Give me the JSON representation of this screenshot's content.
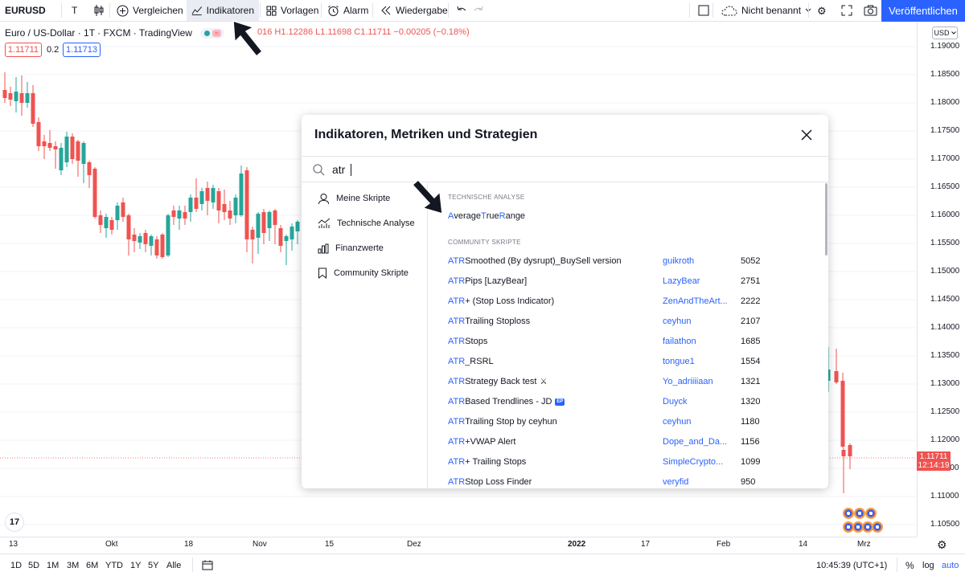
{
  "toolbar": {
    "symbol": "EURUSD",
    "compare_label": "Vergleichen",
    "indicators_label": "Indikatoren",
    "templates_label": "Vorlagen",
    "alert_label": "Alarm",
    "replay_label": "Wiedergabe",
    "layout_name": "Nicht benannt",
    "publish_label": "Veröffentlichen",
    "text_tool": "T"
  },
  "legend": {
    "title": "Euro / US-Dollar · 1T · FXCM · TradingView",
    "ohlc": "016 H1.12286 L1.11698 C1.11711 −0.00205 (−0.18%)",
    "bid": "1.11711",
    "spread": "0.2",
    "ask": "1.11713"
  },
  "price_axis": {
    "currency": "USD",
    "ticks": [
      "1.19000",
      "1.18500",
      "1.18000",
      "1.17500",
      "1.17000",
      "1.16500",
      "1.16000",
      "1.15500",
      "1.15000",
      "1.14500",
      "1.14000",
      "1.13500",
      "1.13000",
      "1.12500",
      "1.12000",
      "1.11500",
      "1.11000",
      "1.10500"
    ],
    "current_price": "1.11711",
    "countdown": "12:14:19"
  },
  "time_axis": {
    "ticks": [
      "13",
      "Okt",
      "18",
      "Nov",
      "15",
      "Dez",
      "2022",
      "17",
      "Feb",
      "14",
      "Mrz"
    ]
  },
  "bottom": {
    "ranges": [
      "1D",
      "5D",
      "1M",
      "3M",
      "6M",
      "YTD",
      "1Y",
      "5Y",
      "Alle"
    ],
    "clock": "10:45:39 (UTC+1)",
    "percent": "%",
    "log": "log",
    "auto": "auto"
  },
  "dialog": {
    "title": "Indikatoren, Metriken und Strategien",
    "search_value": "atr",
    "sidebar": [
      {
        "label": "Meine Skripte",
        "icon": "user-icon"
      },
      {
        "label": "Technische Analyse",
        "icon": "chart-analysis-icon"
      },
      {
        "label": "Finanzwerte",
        "icon": "bar-chart-icon"
      },
      {
        "label": "Community Skripte",
        "icon": "bookmark-icon"
      }
    ],
    "section_technical": "TECHNISCHE ANALYSE",
    "technical_results": [
      {
        "parts": [
          {
            "t": "A",
            "hl": true
          },
          {
            "t": "verage ",
            "hl": false
          },
          {
            "t": "T",
            "hl": true
          },
          {
            "t": "rue ",
            "hl": false
          },
          {
            "t": "R",
            "hl": true
          },
          {
            "t": "ange",
            "hl": false
          }
        ]
      }
    ],
    "section_community": "COMMUNITY SKRIPTE",
    "community_results": [
      {
        "hl": "ATR",
        "rest": " Smoothed (By dysrupt)_BuySell version",
        "author": "guikroth",
        "count": "5052"
      },
      {
        "hl": "ATR",
        "rest": " Pips [LazyBear]",
        "author": "LazyBear",
        "count": "2751"
      },
      {
        "hl": "ATR",
        "rest": "+ (Stop Loss Indicator)",
        "author": "ZenAndTheArt...",
        "count": "2222"
      },
      {
        "hl": "ATR",
        "rest": " Trailing Stoploss",
        "author": "ceyhun",
        "count": "2107"
      },
      {
        "hl": "ATR",
        "rest": " Stops",
        "author": "failathon",
        "count": "1685"
      },
      {
        "hl": "ATR",
        "rest": "_RSRL",
        "author": "tongue1",
        "count": "1554"
      },
      {
        "hl": "ATR",
        "rest": " Strategy Back test",
        "author": "Yo_adriiiiaan",
        "count": "1321",
        "badge_icon": "strategy-icon"
      },
      {
        "hl": "ATR",
        "rest": " Based Trendlines - JD",
        "author": "Duyck",
        "count": "1320",
        "badge": "EP"
      },
      {
        "hl": "ATR",
        "rest": " Trailing Stop by ceyhun",
        "author": "ceyhun",
        "count": "1180"
      },
      {
        "hl": "ATR",
        "rest": "+VWAP Alert",
        "author": "Dope_and_Da...",
        "count": "1156"
      },
      {
        "hl": "ATR",
        "rest": " + Trailing Stops",
        "author": "SimpleCrypto...",
        "count": "1099"
      },
      {
        "hl": "ATR",
        "rest": " Stop Loss Finder",
        "author": "veryfid",
        "count": "950"
      }
    ]
  },
  "colors": {
    "up": "#26a69a",
    "down": "#ef5350",
    "accent": "#2962ff"
  }
}
